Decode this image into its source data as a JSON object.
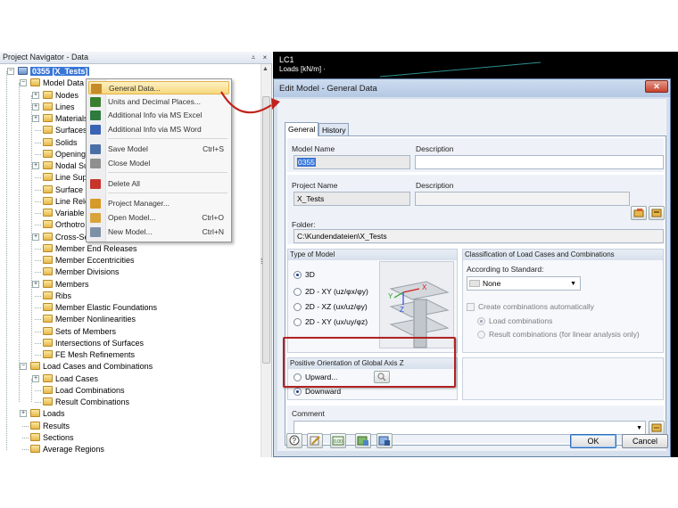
{
  "navigator": {
    "title": "Project Navigator - Data",
    "pin": "⩡",
    "close": "×",
    "items": [
      {
        "label": "0355 [X_Tests]",
        "depth": 0,
        "expander": "-",
        "selected": true
      },
      {
        "label": "Model Data",
        "depth": 1,
        "expander": "-"
      },
      {
        "label": "Nodes",
        "depth": 2,
        "expander": "+"
      },
      {
        "label": "Lines",
        "depth": 2,
        "expander": "+"
      },
      {
        "label": "Materials",
        "depth": 2,
        "expander": "+"
      },
      {
        "label": "Surfaces",
        "depth": 2,
        "expander": ""
      },
      {
        "label": "Solids",
        "depth": 2,
        "expander": ""
      },
      {
        "label": "Openings",
        "depth": 2,
        "expander": ""
      },
      {
        "label": "Nodal Su",
        "depth": 2,
        "expander": "+"
      },
      {
        "label": "Line Sup",
        "depth": 2,
        "expander": ""
      },
      {
        "label": "Surface S",
        "depth": 2,
        "expander": ""
      },
      {
        "label": "Line Rele",
        "depth": 2,
        "expander": ""
      },
      {
        "label": "Variable",
        "depth": 2,
        "expander": ""
      },
      {
        "label": "Orthotro",
        "depth": 2,
        "expander": ""
      },
      {
        "label": "Cross-Se",
        "depth": 2,
        "expander": "+"
      },
      {
        "label": "Member End Releases",
        "depth": 2,
        "expander": ""
      },
      {
        "label": "Member Eccentricities",
        "depth": 2,
        "expander": ""
      },
      {
        "label": "Member Divisions",
        "depth": 2,
        "expander": ""
      },
      {
        "label": "Members",
        "depth": 2,
        "expander": "+"
      },
      {
        "label": "Ribs",
        "depth": 2,
        "expander": ""
      },
      {
        "label": "Member Elastic Foundations",
        "depth": 2,
        "expander": ""
      },
      {
        "label": "Member Nonlinearities",
        "depth": 2,
        "expander": ""
      },
      {
        "label": "Sets of Members",
        "depth": 2,
        "expander": ""
      },
      {
        "label": "Intersections of Surfaces",
        "depth": 2,
        "expander": ""
      },
      {
        "label": "FE Mesh Refinements",
        "depth": 2,
        "expander": ""
      },
      {
        "label": "Load Cases and Combinations",
        "depth": 1,
        "expander": "-"
      },
      {
        "label": "Load Cases",
        "depth": 2,
        "expander": "+"
      },
      {
        "label": "Load Combinations",
        "depth": 2,
        "expander": ""
      },
      {
        "label": "Result Combinations",
        "depth": 2,
        "expander": ""
      },
      {
        "label": "Loads",
        "depth": 1,
        "expander": "+"
      },
      {
        "label": "Results",
        "depth": 1,
        "expander": ""
      },
      {
        "label": "Sections",
        "depth": 1,
        "expander": ""
      },
      {
        "label": "Average Regions",
        "depth": 1,
        "expander": ""
      }
    ]
  },
  "context_menu": {
    "items": [
      {
        "label": "General Data...",
        "shortcut": "",
        "highlight": true,
        "icon": "general-data-icon"
      },
      {
        "label": "Units and Decimal Places...",
        "shortcut": "",
        "icon": "units-icon"
      },
      {
        "label": "Additional Info via MS Excel",
        "shortcut": "",
        "icon": "excel-icon"
      },
      {
        "label": "Additional Info via MS Word",
        "shortcut": "",
        "icon": "word-icon"
      },
      {
        "label": "Save Model",
        "shortcut": "Ctrl+S",
        "icon": "save-icon"
      },
      {
        "label": "Close Model",
        "shortcut": "",
        "icon": "close-model-icon"
      },
      {
        "label": "Delete All",
        "shortcut": "",
        "icon": "delete-icon"
      },
      {
        "label": "Project Manager...",
        "shortcut": "",
        "icon": "project-manager-icon"
      },
      {
        "label": "Open Model...",
        "shortcut": "Ctrl+O",
        "icon": "open-icon"
      },
      {
        "label": "New Model...",
        "shortcut": "Ctrl+N",
        "icon": "new-icon"
      }
    ]
  },
  "view": {
    "lc": "LC1",
    "loads": "Loads [kN/m] ·"
  },
  "dialog": {
    "title": "Edit Model - General Data",
    "close": "✕",
    "tabs": [
      "General",
      "History"
    ],
    "model_name_label": "Model Name",
    "model_name": "0355",
    "description_label": "Description",
    "model_description": "",
    "project_name_label": "Project Name",
    "project_description_label": "Description",
    "project_name": "X_Tests",
    "project_description": "",
    "folder_label": "Folder:",
    "folder": "C:\\Kundendateien\\X_Tests",
    "type_of_model": {
      "title": "Type of Model",
      "options": [
        "3D",
        "2D - XY (uz/φx/φy)",
        "2D - XZ (ux/uz/φy)",
        "2D - XY (ux/uy/φz)"
      ],
      "selected": 0
    },
    "classification": {
      "title": "Classification of Load Cases and Combinations",
      "according_label": "According to Standard:",
      "standard": "None",
      "create_auto_label": "Create combinations automatically",
      "load_combinations": "Load combinations",
      "result_combinations": "Result combinations (for linear analysis only)"
    },
    "axis_z": {
      "title": "Positive Orientation of Global Axis Z",
      "options": [
        "Upward...",
        "Downward"
      ],
      "selected": 1
    },
    "comment_label": "Comment",
    "comment": "",
    "ok_label": "OK",
    "cancel_label": "Cancel",
    "axis_letters": {
      "x": "X",
      "y": "Y",
      "z": "Z"
    }
  }
}
